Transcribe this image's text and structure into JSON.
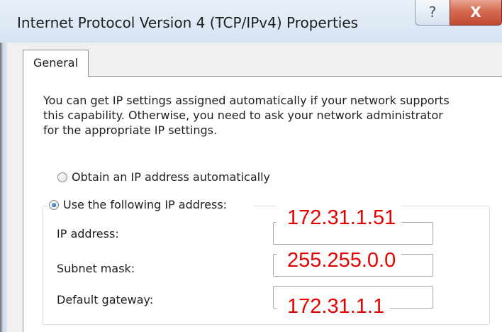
{
  "window": {
    "title": "Internet Protocol Version 4 (TCP/IPv4) Properties",
    "help_label": "?",
    "close_label": "X"
  },
  "tabs": [
    {
      "label": "General",
      "active": true
    }
  ],
  "intro_lines": [
    "You can get IP settings assigned automatically if your network supports",
    "this capability. Otherwise, you need to ask your network administrator",
    "for the appropriate IP settings."
  ],
  "ip_mode": {
    "auto_label": "Obtain an IP address automatically",
    "manual_label": "Use the following IP address:",
    "selected": "manual"
  },
  "fields": {
    "ip_address": {
      "label": "IP address:",
      "value": "172.31.1.51"
    },
    "subnet_mask": {
      "label": "Subnet mask:",
      "value": "255.255.0.0"
    },
    "default_gateway": {
      "label": "Default gateway:",
      "value": "172.31.1.1"
    }
  },
  "colors": {
    "annotation_red": "#e60000",
    "close_red": "#c94f38"
  }
}
